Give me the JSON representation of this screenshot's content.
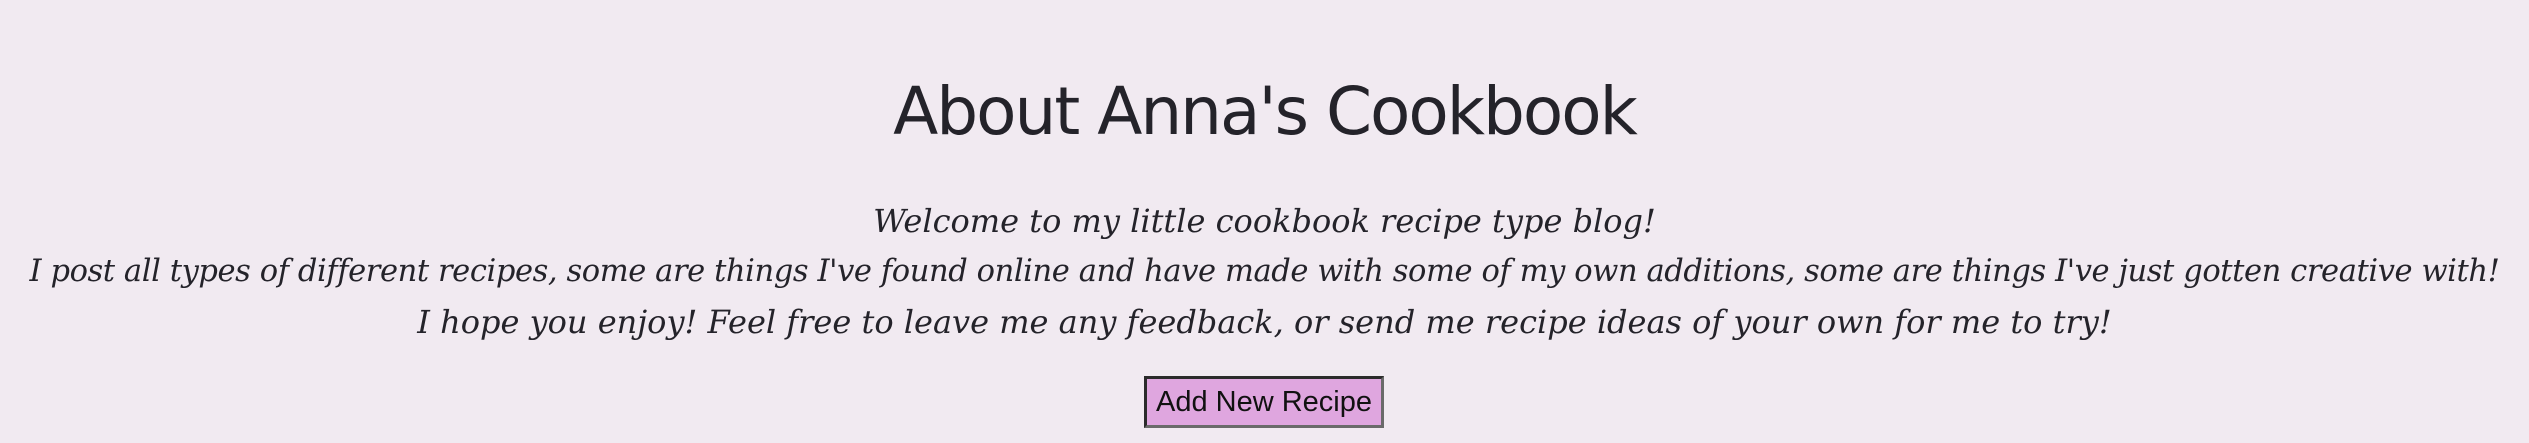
{
  "header": {
    "title": "About Anna's Cookbook"
  },
  "about": {
    "line1": "Welcome to my little cookbook recipe type blog!",
    "line2": "I post all types of different recipes, some are things I've found online and have made with some of my own additions, some are things I've just gotten creative with!",
    "line3": "I hope you enjoy! Feel free to leave me any feedback, or send me recipe ideas of your own for me to try!"
  },
  "actions": {
    "add_recipe_label": "Add New Recipe"
  },
  "colors": {
    "background": "#f1eaf1",
    "text": "#24232a",
    "button": "#dfa6df"
  }
}
